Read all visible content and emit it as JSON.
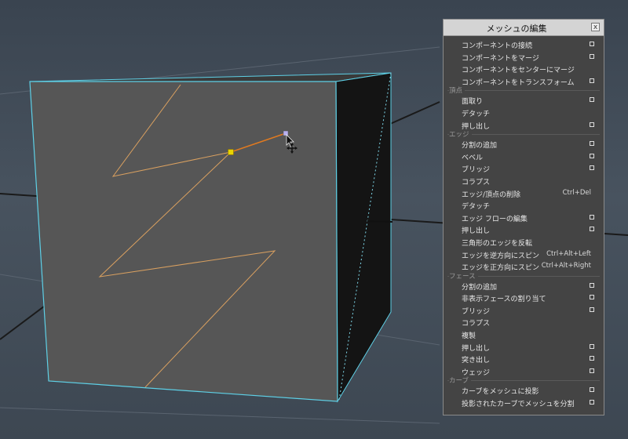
{
  "panel": {
    "title": "メッシュの編集",
    "close_label": "x",
    "rows": [
      {
        "kind": "item",
        "label": "コンポーネントの接続",
        "option": true
      },
      {
        "kind": "item",
        "label": "コンポーネントをマージ",
        "option": true
      },
      {
        "kind": "item",
        "label": "コンポーネントをセンターにマージ",
        "option": false
      },
      {
        "kind": "item",
        "label": "コンポーネントをトランスフォーム",
        "option": true
      },
      {
        "kind": "section",
        "label": "頂点"
      },
      {
        "kind": "item",
        "label": "面取り",
        "option": true
      },
      {
        "kind": "item",
        "label": "デタッチ",
        "option": false
      },
      {
        "kind": "item",
        "label": "押し出し",
        "option": true
      },
      {
        "kind": "section",
        "label": "エッジ"
      },
      {
        "kind": "item",
        "label": "分割の追加",
        "option": true
      },
      {
        "kind": "item",
        "label": "ベベル",
        "option": true
      },
      {
        "kind": "item",
        "label": "ブリッジ",
        "option": true
      },
      {
        "kind": "item",
        "label": "コラプス",
        "option": false
      },
      {
        "kind": "item",
        "label": "エッジ/頂点の削除",
        "shortcut": "Ctrl+Del",
        "option": false
      },
      {
        "kind": "item",
        "label": "デタッチ",
        "option": false
      },
      {
        "kind": "item",
        "label": "エッジ フローの編集",
        "option": true
      },
      {
        "kind": "item",
        "label": "押し出し",
        "option": true
      },
      {
        "kind": "item",
        "label": "三角形のエッジを反転",
        "option": false
      },
      {
        "kind": "item",
        "label": "エッジを逆方向にスピン",
        "shortcut": "Ctrl+Alt+Left",
        "option": false
      },
      {
        "kind": "item",
        "label": "エッジを正方向にスピン",
        "shortcut": "Ctrl+Alt+Right",
        "option": false
      },
      {
        "kind": "section",
        "label": "フェース"
      },
      {
        "kind": "item",
        "label": "分割の追加",
        "option": true
      },
      {
        "kind": "item",
        "label": "非表示フェースの割り当て",
        "option": true
      },
      {
        "kind": "item",
        "label": "ブリッジ",
        "option": true
      },
      {
        "kind": "item",
        "label": "コラプス",
        "option": false
      },
      {
        "kind": "item",
        "label": "複製",
        "option": false
      },
      {
        "kind": "item",
        "label": "押し出し",
        "option": true
      },
      {
        "kind": "item",
        "label": "突き出し",
        "option": true
      },
      {
        "kind": "item",
        "label": "ウェッジ",
        "option": true
      },
      {
        "kind": "section",
        "label": "カーブ"
      },
      {
        "kind": "item",
        "label": "カーブをメッシュに投影",
        "option": true
      },
      {
        "kind": "item",
        "label": "投影されたカーブでメッシュを分割",
        "option": true
      }
    ]
  },
  "colors": {
    "cube_front": "#565656",
    "cube_side": "#141414",
    "selection_outline": "#5ed0e6",
    "edge_line": "#d9a060",
    "active_edge": "#e07a20",
    "vertex_yellow": "#e8d400",
    "vertex_lilac": "#b8b0f0"
  }
}
